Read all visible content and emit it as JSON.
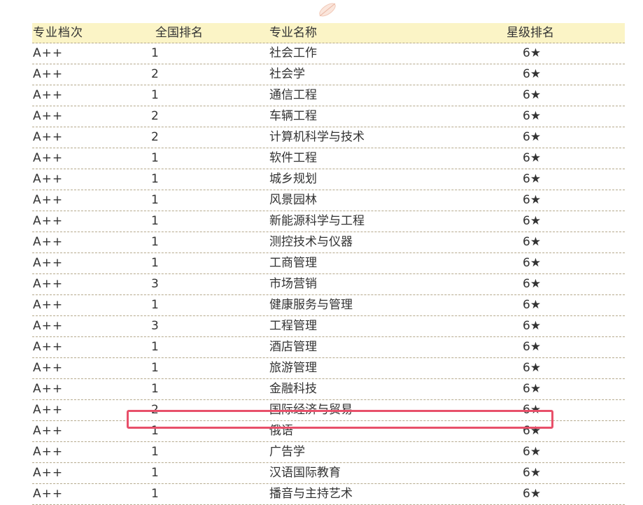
{
  "header": {
    "level": "专业档次",
    "rank": "全国排名",
    "major": "专业名称",
    "stars": "星级排名"
  },
  "rows": [
    {
      "level": "A++",
      "rank": "1",
      "major": "社会工作",
      "stars": "6★"
    },
    {
      "level": "A++",
      "rank": "2",
      "major": "社会学",
      "stars": "6★"
    },
    {
      "level": "A++",
      "rank": "1",
      "major": "通信工程",
      "stars": "6★"
    },
    {
      "level": "A++",
      "rank": "2",
      "major": "车辆工程",
      "stars": "6★"
    },
    {
      "level": "A++",
      "rank": "2",
      "major": "计算机科学与技术",
      "stars": "6★"
    },
    {
      "level": "A++",
      "rank": "1",
      "major": " 软件工程",
      "stars": "6★"
    },
    {
      "level": "A++",
      "rank": "1",
      "major": "城乡规划",
      "stars": "6★"
    },
    {
      "level": "A++",
      "rank": "1",
      "major": "风景园林",
      "stars": "6★"
    },
    {
      "level": "A++",
      "rank": "1",
      "major": "新能源科学与工程",
      "stars": "6★"
    },
    {
      "level": "A++",
      "rank": "1",
      "major": "测控技术与仪器",
      "stars": "6★"
    },
    {
      "level": "A++",
      "rank": "1",
      "major": "工商管理",
      "stars": "6★"
    },
    {
      "level": "A++",
      "rank": "3",
      "major": "市场营销",
      "stars": "6★"
    },
    {
      "level": "A++",
      "rank": "1",
      "major": "健康服务与管理",
      "stars": "6★"
    },
    {
      "level": "A++",
      "rank": "3",
      "major": "工程管理",
      "stars": "6★"
    },
    {
      "level": "A++",
      "rank": "1",
      "major": "酒店管理",
      "stars": "6★"
    },
    {
      "level": "A++",
      "rank": "1",
      "major": " 旅游管理",
      "stars": "6★"
    },
    {
      "level": "A++",
      "rank": "1",
      "major": "金融科技",
      "stars": "6★"
    },
    {
      "level": "A++",
      "rank": "2",
      "major": "国际经济与贸易",
      "stars": "6★"
    },
    {
      "level": "A++",
      "rank": "1",
      "major": "俄语",
      "stars": "6★"
    },
    {
      "level": "A++",
      "rank": "1",
      "major": "广告学",
      "stars": "6★"
    },
    {
      "level": "A++",
      "rank": "1",
      "major": "汉语国际教育",
      "stars": "6★"
    },
    {
      "level": "A++",
      "rank": "1",
      "major": "播音与主持艺术",
      "stars": "6★"
    }
  ],
  "colors": {
    "header_bg": "#fbf4c6",
    "row_divider": "#b5a98c",
    "highlight_border": "#e8506a"
  }
}
